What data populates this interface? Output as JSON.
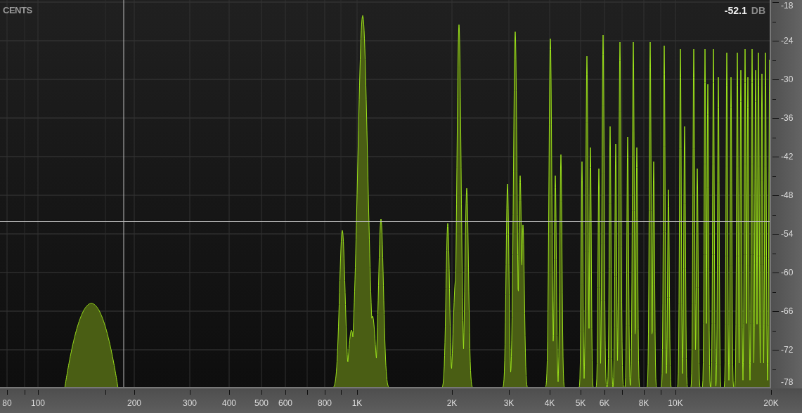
{
  "header": {
    "label": "CENTS"
  },
  "readout": {
    "value": "-52.1",
    "unit": "DB"
  },
  "y_axis": {
    "ticks": [
      "-18",
      "-24",
      "-30",
      "-36",
      "-42",
      "-48",
      "-54",
      "-60",
      "-66",
      "-72",
      "-78"
    ]
  },
  "x_axis": {
    "ticks": [
      "80",
      "100",
      "200",
      "300",
      "400",
      "500",
      "600",
      "800",
      "1K",
      "2K",
      "3K",
      "4K",
      "5K",
      "6K",
      "8K",
      "10K",
      "20K"
    ]
  }
}
